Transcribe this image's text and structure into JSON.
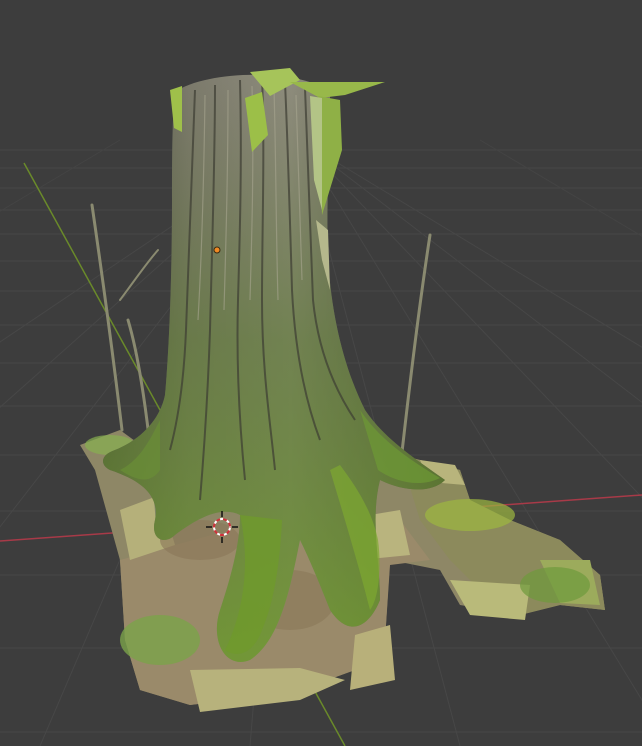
{
  "app": {
    "name": "3D Viewport",
    "colors": {
      "background": "#3d3d3d",
      "grid_line": "#4a4a4a",
      "x_axis": "#a83a48",
      "y_axis": "#6a8a2a",
      "origin_point": "#f08a24"
    }
  },
  "viewport": {
    "object": "tree-stump-scan",
    "cursor_icon": "3d-cursor-icon"
  }
}
